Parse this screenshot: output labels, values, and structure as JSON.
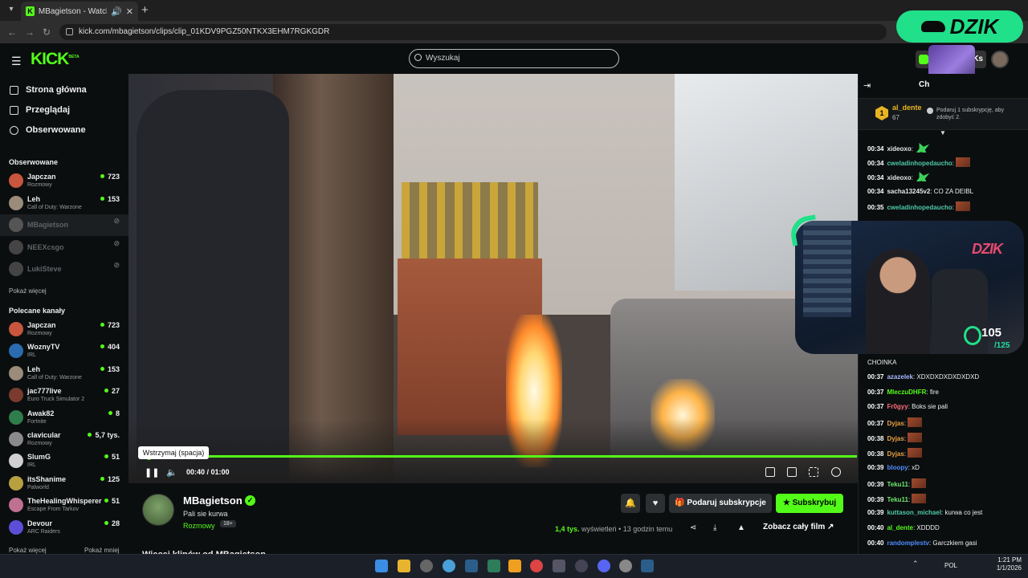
{
  "browser": {
    "tab_title": "MBagietson - Watch clips o",
    "url": "kick.com/mbagietson/clips/clip_01KDV9PGZ50NTKX3EHM7RGKGDR"
  },
  "overlay_brand": "DZIK",
  "header": {
    "logo": "KICK",
    "logo_sup": "BETA",
    "search_placeholder": "Wyszukaj",
    "user_btn": "Ks"
  },
  "sidebar": {
    "nav": [
      {
        "label": "Strona główna",
        "icon": "home-icon"
      },
      {
        "label": "Przeglądaj",
        "icon": "browse-icon"
      },
      {
        "label": "Obserwowane",
        "icon": "heart-icon"
      }
    ],
    "followed_title": "Obserwowane",
    "followed": [
      {
        "name": "Japczan",
        "category": "Rozmowy",
        "viewers": "723",
        "online": true,
        "color": "#c8553d"
      },
      {
        "name": "Leh",
        "category": "Call of Duty: Warzone",
        "viewers": "153",
        "online": true,
        "color": "#9a8b7a"
      },
      {
        "name": "MBagietson",
        "category": "",
        "viewers": "",
        "online": false,
        "color": "#555"
      },
      {
        "name": "NEEXcsgo",
        "category": "",
        "viewers": "",
        "online": false,
        "color": "#444"
      },
      {
        "name": "LukiSteve",
        "category": "",
        "viewers": "",
        "online": false,
        "color": "#444"
      }
    ],
    "followed_more": "Pokaż więcej",
    "recommended_title": "Polecane kanały",
    "recommended": [
      {
        "name": "Japczan",
        "category": "Rozmowy",
        "viewers": "723",
        "color": "#c8553d"
      },
      {
        "name": "WoznyTV",
        "category": "IRL",
        "viewers": "404",
        "color": "#2b6cb0"
      },
      {
        "name": "Leh",
        "category": "Call of Duty: Warzone",
        "viewers": "153",
        "color": "#9a8b7a"
      },
      {
        "name": "jac777live",
        "category": "Euro Truck Simulator 2",
        "viewers": "27",
        "color": "#7a3b2e"
      },
      {
        "name": "Awak82",
        "category": "Fortnite",
        "viewers": "8",
        "color": "#2f7d4a"
      },
      {
        "name": "clavicular",
        "category": "Rozmowy",
        "viewers": "5,7 tys.",
        "color": "#8a8a8a"
      },
      {
        "name": "SlumG",
        "category": "IRL",
        "viewers": "51",
        "color": "#d0d0d0"
      },
      {
        "name": "itsShanime",
        "category": "Palworld",
        "viewers": "125",
        "color": "#b8a040"
      },
      {
        "name": "TheHealingWhisperer",
        "category": "Escape From Tarkov",
        "viewers": "51",
        "color": "#c07090"
      },
      {
        "name": "Devour",
        "category": "ARC Raiders",
        "viewers": "28",
        "color": "#5b4fd8"
      }
    ],
    "rec_more": "Pokaż więcej",
    "rec_less": "Pokaż mniej"
  },
  "player": {
    "tooltip": "Wstrzymaj (spacja)",
    "time": "00:40 / 01:00",
    "progress": 0.667
  },
  "clip": {
    "channel": "MBagietson",
    "title": "Pali sie kurwa",
    "category": "Rozmowy",
    "age_badge": "18+",
    "gift_label": "Podaruj subskrypcje",
    "subscribe_label": "Subskrybuj",
    "views": "1,4 tys.",
    "views_word": "wyświetleń",
    "age": "• 13 godzin temu",
    "watch_full": "Zobacz cały film",
    "more_clips": "Więcej klipów od MBagietson"
  },
  "chat": {
    "title": "Ch",
    "pinned_user": "al_dente",
    "pinned_count": "67",
    "pinned_message": "Podaruj 1 subskrypcję, aby zdobyć 2.",
    "messages": [
      {
        "ts": "00:34",
        "user": "xideoxo",
        "color": "#e8e8e8",
        "text": "",
        "emote": "g"
      },
      {
        "ts": "00:34",
        "user": "cweladinhopedaucho",
        "color": "#4ec9a8",
        "text": "",
        "emote": "b"
      },
      {
        "ts": "00:34",
        "user": "xideoxo",
        "color": "#e8e8e8",
        "text": "",
        "emote": "g"
      },
      {
        "ts": "00:34",
        "user": "sacha13245v2",
        "color": "#e8e8e8",
        "text": "CO ZA DEIBL",
        "emote": ""
      },
      {
        "ts": "00:35",
        "user": "cweladinhopedaucho",
        "color": "#4ec9a8",
        "text": "",
        "emote": "b"
      },
      {
        "ts": "",
        "user": "",
        "color": "#e8e8e8",
        "text": "CHOINKA",
        "emote": ""
      },
      {
        "ts": "00:37",
        "user": "azazelek",
        "color": "#a7b7ff",
        "text": "XDXDXDXDXDXDXD",
        "emote": ""
      },
      {
        "ts": "00:37",
        "user": "MleczuDHFR",
        "color": "#53fc18",
        "text": "fire",
        "emote": ""
      },
      {
        "ts": "00:37",
        "user": "Fr0gyy",
        "color": "#ff6b7a",
        "text": "Boks sie pali",
        "emote": ""
      },
      {
        "ts": "00:37",
        "user": "Dyjas",
        "color": "#e8a040",
        "text": "",
        "emote": "b"
      },
      {
        "ts": "00:38",
        "user": "Dyjas",
        "color": "#e8a040",
        "text": "",
        "emote": "b"
      },
      {
        "ts": "00:38",
        "user": "Dyjas",
        "color": "#e8a040",
        "text": "",
        "emote": "b"
      },
      {
        "ts": "00:39",
        "user": "bloopy",
        "color": "#4f8cff",
        "text": "xD",
        "emote": ""
      },
      {
        "ts": "00:39",
        "user": "Teku11",
        "color": "#6ee86e",
        "text": "",
        "emote": "b"
      },
      {
        "ts": "00:39",
        "user": "Teku11",
        "color": "#6ee86e",
        "text": "",
        "emote": "b"
      },
      {
        "ts": "00:39",
        "user": "kuttason_michael",
        "color": "#4ec9a8",
        "text": "kurwa co jest",
        "emote": ""
      },
      {
        "ts": "00:40",
        "user": "al_dente",
        "color": "#53fc18",
        "text": "XDDDD",
        "emote": ""
      },
      {
        "ts": "00:40",
        "user": "randomplestv",
        "color": "#4f8cff",
        "text": "Garczkiem gasi",
        "emote": ""
      }
    ]
  },
  "webcam": {
    "logo": "DZIK",
    "count": "105",
    "count_sub": "/125"
  },
  "taskbar": {
    "lang": "POL",
    "time": "1:21 PM",
    "date": "1/1/2026"
  }
}
